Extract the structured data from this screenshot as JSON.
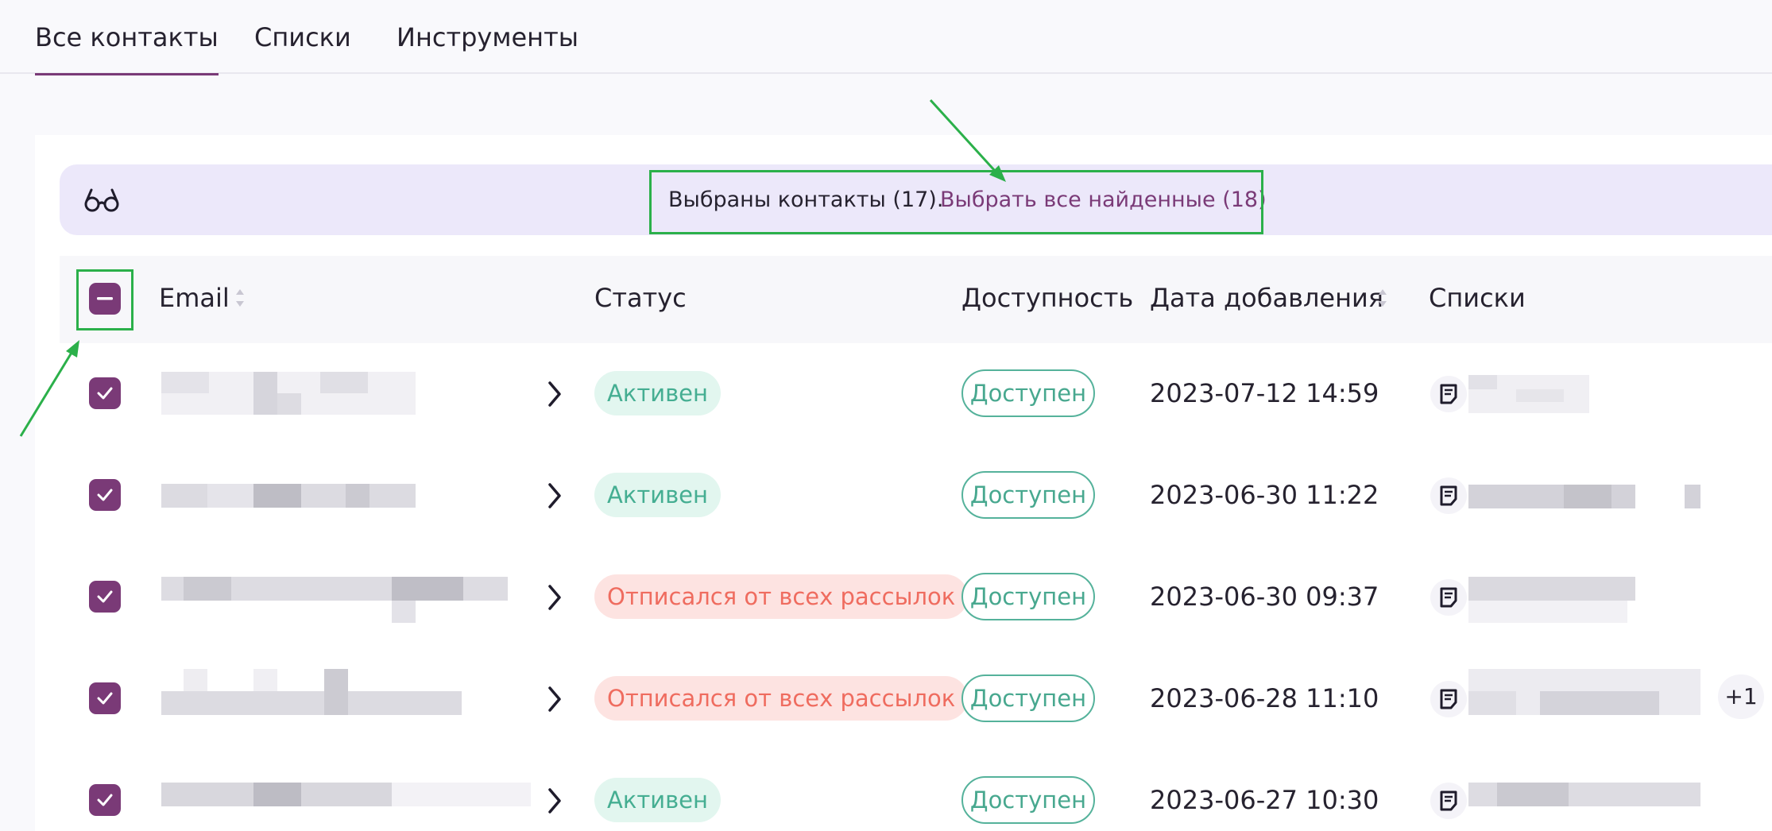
{
  "tabs": [
    {
      "label": "Все контакты",
      "active": true
    },
    {
      "label": "Списки",
      "active": false
    },
    {
      "label": "Инструменты",
      "active": false
    }
  ],
  "selection": {
    "icon": "glasses-icon",
    "text": "Выбраны контакты (17).",
    "link": "Выбрать все найденные (18)"
  },
  "table": {
    "columns": [
      "Email",
      "Статус",
      "Доступность",
      "Дата добавления",
      "Списки"
    ],
    "rows": [
      {
        "status": "Активен",
        "availability": "Доступен",
        "date": "2023-07-12 14:59"
      },
      {
        "status": "Активен",
        "availability": "Доступен",
        "date": "2023-06-30 11:22"
      },
      {
        "status": "Отписался от всех рассылок",
        "availability": "Доступен",
        "date": "2023-06-30 09:37"
      },
      {
        "status": "Отписался от всех рассылок",
        "availability": "Доступен",
        "date": "2023-06-28 11:10",
        "extra_lists": "+1"
      },
      {
        "status": "Активен",
        "availability": "Доступен",
        "date": "2023-06-27 10:30"
      }
    ]
  },
  "colors": {
    "accent": "#7a3a77",
    "active_badge_bg": "#e2f6ef",
    "active_badge_text": "#45ae92",
    "unsub_badge_bg": "#fde3e1",
    "unsub_badge_text": "#ef6c5f",
    "available_border": "#55b29b",
    "annotation_green": "#2bb04a"
  }
}
